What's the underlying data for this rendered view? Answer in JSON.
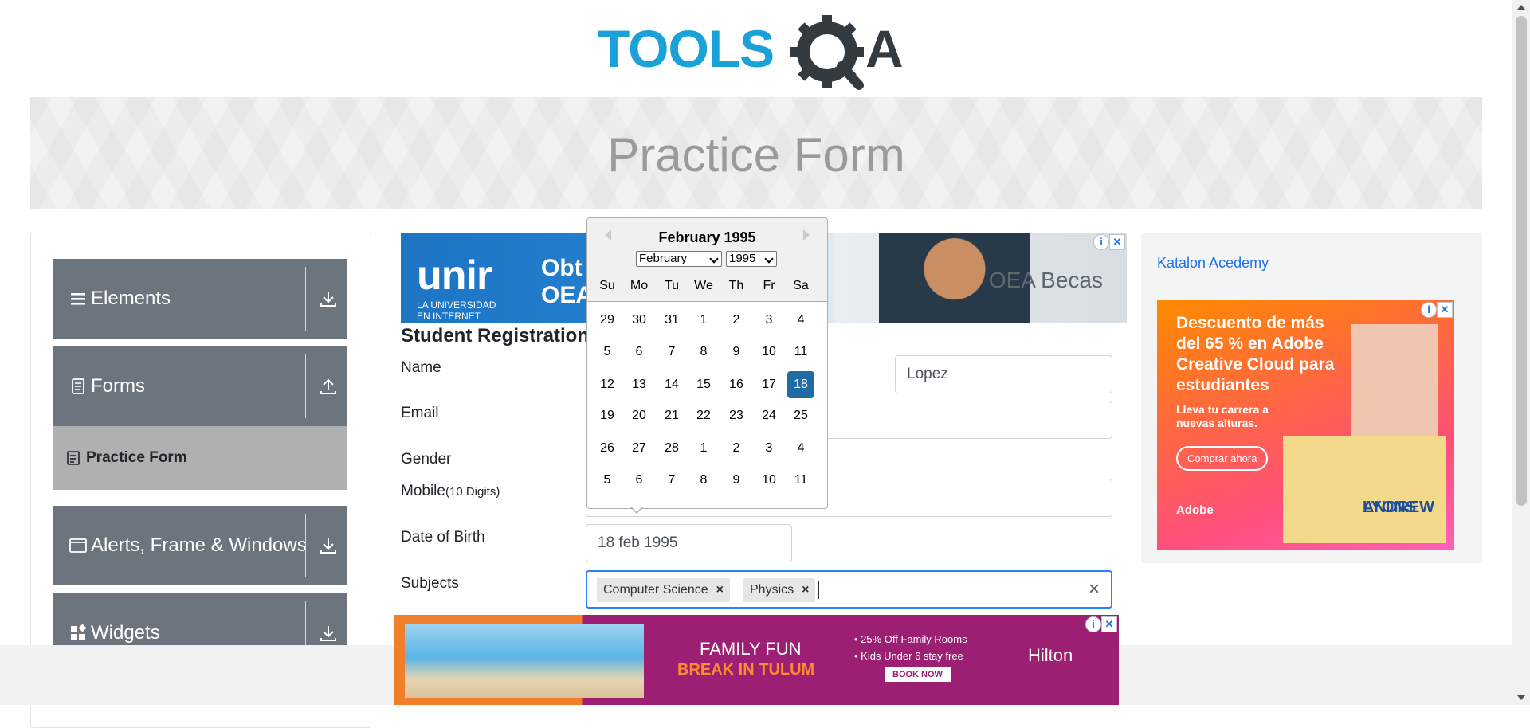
{
  "header": {
    "logo_text": "TOOLSQA",
    "banner_title": "Practice Form"
  },
  "sidebar": {
    "groups": [
      {
        "label": "Elements",
        "icon": "hamburger-icon",
        "arrow": "download-icon"
      },
      {
        "label": "Forms",
        "icon": "document-icon",
        "arrow": "upload-icon"
      },
      {
        "label": "Alerts, Frame & Windows",
        "icon": "window-icon",
        "arrow": "download-icon"
      },
      {
        "label": "Widgets",
        "icon": "widgets-icon",
        "arrow": "download-icon"
      }
    ],
    "active_item": {
      "label": "Practice Form",
      "icon": "form-icon"
    }
  },
  "form": {
    "title": "Student Registration",
    "labels": {
      "name": "Name",
      "email": "Email",
      "gender": "Gender",
      "mobile": "Mobile",
      "mobile_hint": "(10 Digits)",
      "dob": "Date of Birth",
      "subjects": "Subjects"
    },
    "last_name_value": "Lopez",
    "dob_value": "18 feb 1995",
    "subjects": [
      "Computer Science",
      "Physics"
    ],
    "clear_label": "×",
    "chip_remove_label": "×"
  },
  "datepicker": {
    "current_month_label": "February 1995",
    "month_select": "February",
    "year_select": "1995",
    "weekdays": [
      "Su",
      "Mo",
      "Tu",
      "We",
      "Th",
      "Fr",
      "Sa"
    ],
    "weeks": [
      [
        "29",
        "30",
        "31",
        "1",
        "2",
        "3",
        "4"
      ],
      [
        "5",
        "6",
        "7",
        "8",
        "9",
        "10",
        "11"
      ],
      [
        "12",
        "13",
        "14",
        "15",
        "16",
        "17",
        "18"
      ],
      [
        "19",
        "20",
        "21",
        "22",
        "23",
        "24",
        "25"
      ],
      [
        "26",
        "27",
        "28",
        "1",
        "2",
        "3",
        "4"
      ],
      [
        "5",
        "6",
        "7",
        "8",
        "9",
        "10",
        "11"
      ]
    ],
    "selected_day": "18",
    "selected_color": "#216ba5"
  },
  "ads": {
    "top": {
      "brand": "unir",
      "brand_sub_line1": "LA UNIVERSIDAD",
      "brand_sub_line2": "EN INTERNET",
      "headline_line1": "Obt",
      "headline_line2": "OEA",
      "partner": "OEA Becas"
    },
    "side": {
      "link_text": "Katalon Acedemy",
      "headline": "Descuento de más del 65 % en Adobe Creative Cloud para estudiantes",
      "subline": "Lleva tu carrera a nuevas alturas.",
      "cta": "Comprar ahora",
      "card_name_line1": "ANDREW",
      "card_name_line2": "LYONS",
      "brand": "Adobe"
    },
    "bottom": {
      "line1": "FAMILY FUN",
      "line2": "BREAK IN TULUM",
      "offer1": "• 25% Off Family Rooms",
      "offer2": "• Kids Under 6 stay free",
      "cta": "BOOK NOW",
      "brand": "Hilton"
    },
    "close_label": "✕",
    "info_label": "i"
  },
  "colors": {
    "sidebar_group": "#6c757d",
    "sidebar_active": "#b0b0b0",
    "logo_blue": "#1aa1d8",
    "logo_dark": "#333a40",
    "focus_border": "#2684ff"
  }
}
